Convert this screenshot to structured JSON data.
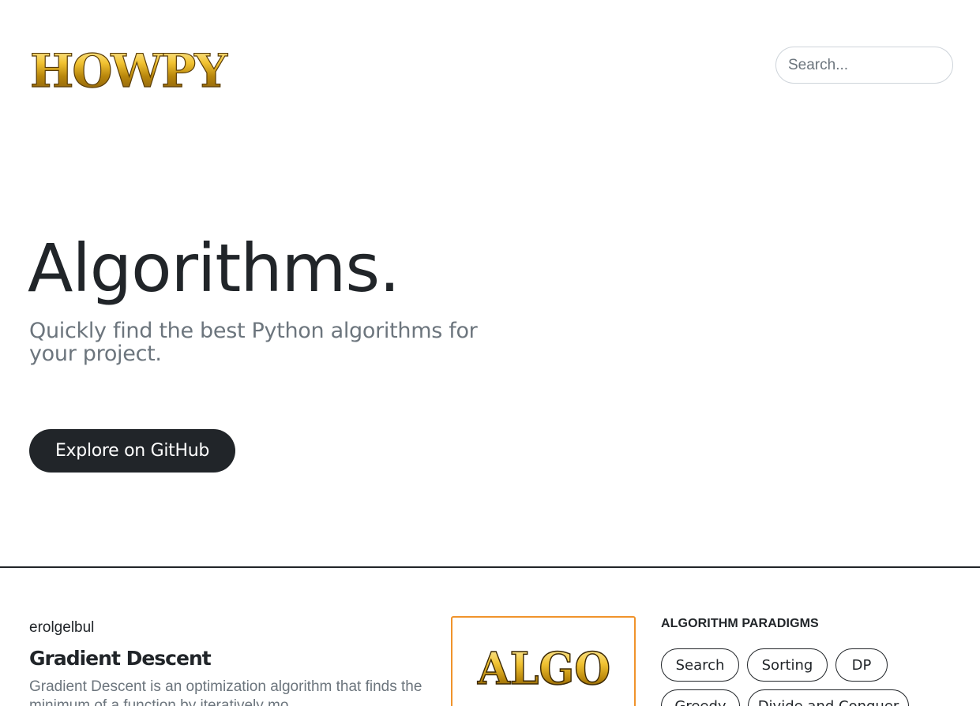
{
  "header": {
    "logo_text": "HOWPY",
    "search_placeholder": "Search..."
  },
  "hero": {
    "title": "Algorithms.",
    "subtitle": "Quickly find the best Python algorithms for your project.",
    "cta_label": "Explore on GitHub"
  },
  "post": {
    "author": "erolgelbul",
    "title": "Gradient Descent",
    "excerpt": "Gradient Descent is an optimization algorithm that finds the minimum of a function by iteratively mo...",
    "thumbnail_text": "ALGO"
  },
  "sidebar": {
    "heading": "ALGORITHM PARADIGMS",
    "tags": [
      "Search",
      "Sorting",
      "DP",
      "Greedy",
      "Divide and Conquer"
    ]
  },
  "colors": {
    "dark": "#212529",
    "muted": "#6c757d",
    "gold": "#d4a017",
    "thumb_border": "#f0932b"
  }
}
